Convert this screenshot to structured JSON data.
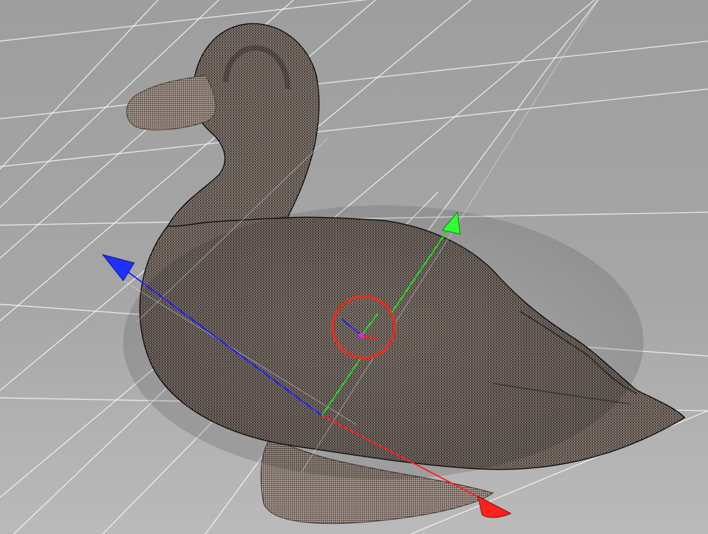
{
  "viewport": {
    "background_top": "#9c9c9c",
    "background_bottom": "#b4b4b4",
    "grid_color": "#ffffff"
  },
  "model": {
    "icon": "duck-point-cloud",
    "dot_color": "#1a1a1a",
    "tint_color": "#8a7a70"
  },
  "gizmo": {
    "x_axis_color": "#ff2020",
    "y_axis_color": "#20e020",
    "z_axis_color": "#2020ff",
    "pivot_ring_color": "#e03020",
    "pivot_center_color": "#e020e0"
  }
}
